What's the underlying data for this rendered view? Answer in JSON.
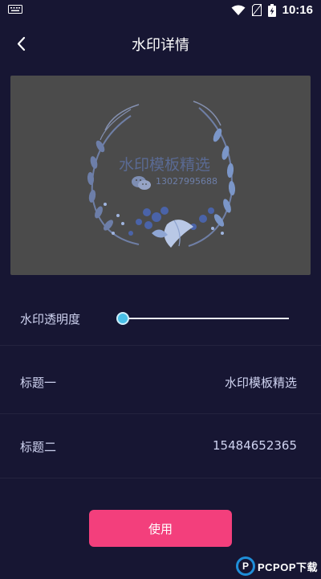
{
  "status_bar": {
    "time": "10:16"
  },
  "header": {
    "title": "水印详情"
  },
  "preview": {
    "watermark_text": "水印模板精选",
    "watermark_phone": "13027995688"
  },
  "opacity": {
    "label": "水印透明度",
    "value": 0
  },
  "rows": [
    {
      "label": "标题一",
      "value": "水印模板精选"
    },
    {
      "label": "标题二",
      "value": "15484652365"
    }
  ],
  "actions": {
    "use_label": "使用"
  },
  "watermark_logo": {
    "text": "PCPOP下载"
  },
  "colors": {
    "background": "#171633",
    "accent": "#f33f7c",
    "slider_knob": "#49c0e8"
  }
}
